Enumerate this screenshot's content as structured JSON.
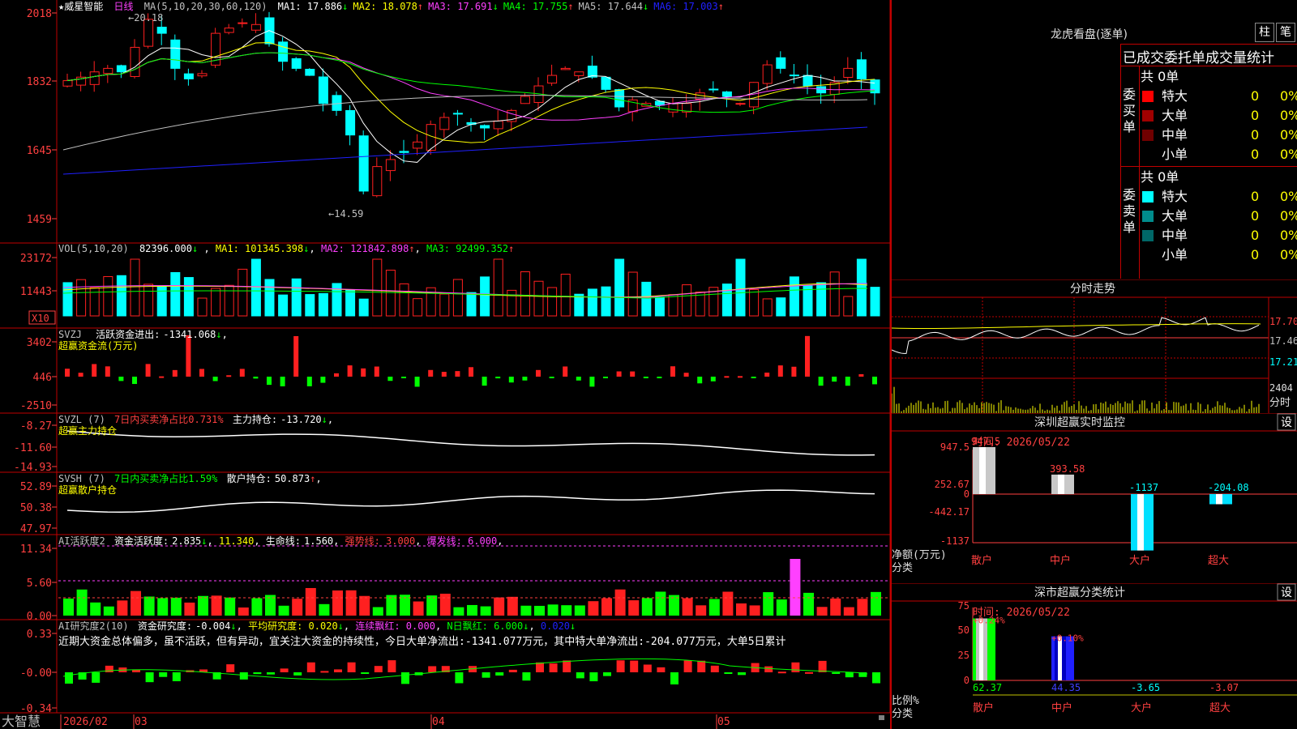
{
  "colors": {
    "up": "#ff2020",
    "down": "#00ffff",
    "ma1": "#ffffff",
    "ma2": "#ffff00",
    "ma3": "#ff40ff",
    "ma4": "#00ff00",
    "ma5": "#c0c0c0",
    "ma6": "#2020ff",
    "grid": "#c00000",
    "axis": "#ff4040"
  },
  "stock": {
    "name": "★威星智能",
    "period": "日线"
  },
  "main": {
    "params": "MA(5,10,20,30,60,120)",
    "ma": [
      {
        "label": "MA1:",
        "value": "17.886",
        "arrow": "↓",
        "color": "#ffffff"
      },
      {
        "label": "MA2:",
        "value": "18.078",
        "arrow": "↑",
        "color": "#ffff00"
      },
      {
        "label": "MA3:",
        "value": "17.691",
        "arrow": "↓",
        "color": "#ff40ff"
      },
      {
        "label": "MA4:",
        "value": "17.755",
        "arrow": "↑",
        "color": "#00ff00"
      },
      {
        "label": "MA5:",
        "value": "17.644",
        "arrow": "↓",
        "color": "#c0c0c0"
      },
      {
        "label": "MA6:",
        "value": "17.003",
        "arrow": "↑",
        "color": "#2020ff"
      }
    ],
    "yticks": [
      "2018",
      "1832",
      "1645",
      "1459"
    ],
    "high_label": "←20.18",
    "low_label": "←14.59"
  },
  "vol": {
    "params": "VOL(5,10,20)",
    "value": "82396.000",
    "arrow": "↓",
    "ma": [
      {
        "label": "MA1:",
        "value": "101345.398",
        "arrow": "↓",
        "color": "#ffff00"
      },
      {
        "label": "MA2:",
        "value": "121842.898",
        "arrow": "↑",
        "color": "#ff40ff"
      },
      {
        "label": "MA3:",
        "value": "92499.352",
        "arrow": "↑",
        "color": "#00ff00"
      }
    ],
    "yticks": [
      "23172",
      "11443"
    ],
    "unit": "X10"
  },
  "svzj": {
    "name": "SVZJ",
    "label": "活跃资金进出:",
    "value": "-1341.068",
    "arrow": "↓",
    "sub": "超赢资金流(万元)",
    "yticks": [
      "3402",
      "446",
      "-2510"
    ]
  },
  "svzl": {
    "name": "SVZL (7)",
    "ratio": "7日内买卖净占比0.731%",
    "label": "主力持仓:",
    "value": "-13.720",
    "arrow": "↓",
    "sub": "超赢主力持仓",
    "yticks": [
      "-8.27",
      "-11.60",
      "-14.93"
    ]
  },
  "svsh": {
    "name": "SVSH (7)",
    "ratio": "7日内买卖净占比1.59%",
    "label": "散户持仓:",
    "value": "50.873",
    "arrow": "↑",
    "sub": "超赢散户持仓",
    "yticks": [
      "52.89",
      "50.38",
      "47.97"
    ]
  },
  "ai1": {
    "name": "AI活跃度2",
    "label": "资金活跃度:",
    "value": "2.835",
    "arrow": "↓",
    "v2": "11.340",
    "label3": "生命线:",
    "v3": "1.560",
    "strong": "强势线: 3.000",
    "burst": "爆发线: 6.000",
    "yticks": [
      "11.34",
      "5.60",
      "0.00"
    ]
  },
  "ai2": {
    "name": "AI研究度2(10)",
    "label": "资金研究度:",
    "value": "-0.004",
    "arrow": "↓",
    "avg": "平均研究度: 0.020",
    "arrow2": "↓",
    "lx": "连续飘红: 0.000",
    "nr": "N日飘红: 6.000",
    "arrow3": "↓",
    "last": "0.020",
    "arrow4": "↓",
    "comment": "近期大资金总体偏多，虽不活跃，但有异动，宜关注大资金的持续性，今日大单净流出:-1341.077万元，其中特大单净流出:-204.077万元，大单5日累计",
    "yticks": [
      "0.33",
      "-0.00",
      "-0.34"
    ]
  },
  "xaxis": {
    "brand": "大智慧",
    "labels": [
      "2026/02",
      "03",
      "04",
      "05"
    ]
  },
  "dragon": {
    "title": "龙虎看盘(逐单)",
    "btn1": "柱",
    "btn2": "笔",
    "stats_title": "已成交委托单成交量统计",
    "buy_label": "委买单",
    "sell_label": "委卖单",
    "buy": {
      "total": "共 0单",
      "rows": [
        {
          "name": "特大",
          "color": "#ff0000",
          "v": "0",
          "p": "0%"
        },
        {
          "name": "大单",
          "color": "#a00000",
          "v": "0",
          "p": "0%"
        },
        {
          "name": "中单",
          "color": "#700000",
          "v": "0",
          "p": "0%"
        },
        {
          "name": "小单",
          "color": "",
          "v": "0",
          "p": "0%"
        }
      ]
    },
    "sell": {
      "total": "共 0单",
      "rows": [
        {
          "name": "特大",
          "color": "#00ffff",
          "v": "0",
          "p": "0%"
        },
        {
          "name": "大单",
          "color": "#008c8c",
          "v": "0",
          "p": "0%"
        },
        {
          "name": "中单",
          "color": "#006868",
          "v": "0",
          "p": "0%"
        },
        {
          "name": "小单",
          "color": "",
          "v": "0",
          "p": "0%"
        }
      ]
    }
  },
  "intraday": {
    "title": "分时走势",
    "yticks": [
      "17.70",
      "17.46",
      "17.21"
    ],
    "vol_top": "2404",
    "vol_label": "分时"
  },
  "sz_monitor": {
    "title": "深圳超赢实时监控",
    "btn": "设",
    "date": "时间: 2026/05/22",
    "yticks": [
      "947.5",
      "252.67",
      "0",
      "-442.17",
      "-1137"
    ],
    "ylabel": "净额(万元)",
    "xlabel": "分类",
    "cats": [
      "散户",
      "中户",
      "大户",
      "超大"
    ],
    "values": [
      947.5,
      393.58,
      -1137,
      -204.08
    ],
    "labels": [
      "947.5",
      "393.58",
      "-1137",
      "-204.08"
    ]
  },
  "sz_class": {
    "title": "深市超赢分类统计",
    "btn": "设",
    "date": "时间: 2026/05/22",
    "yticks": [
      "75",
      "50",
      "25",
      "0"
    ],
    "ylabel": "比例%",
    "xlabel": "分类",
    "cats": [
      "散户",
      "中户",
      "大户",
      "超大"
    ],
    "values": [
      62.37,
      44.35,
      -3.65,
      -3.07
    ],
    "labels": [
      "62.37",
      "44.35",
      "-3.65",
      "-3.07"
    ],
    "tops": [
      "+0.24%",
      "+0.10%"
    ],
    "label_colors": [
      "#00ff00",
      "#4040ff",
      "#00ffff",
      "#ff4040"
    ]
  }
}
